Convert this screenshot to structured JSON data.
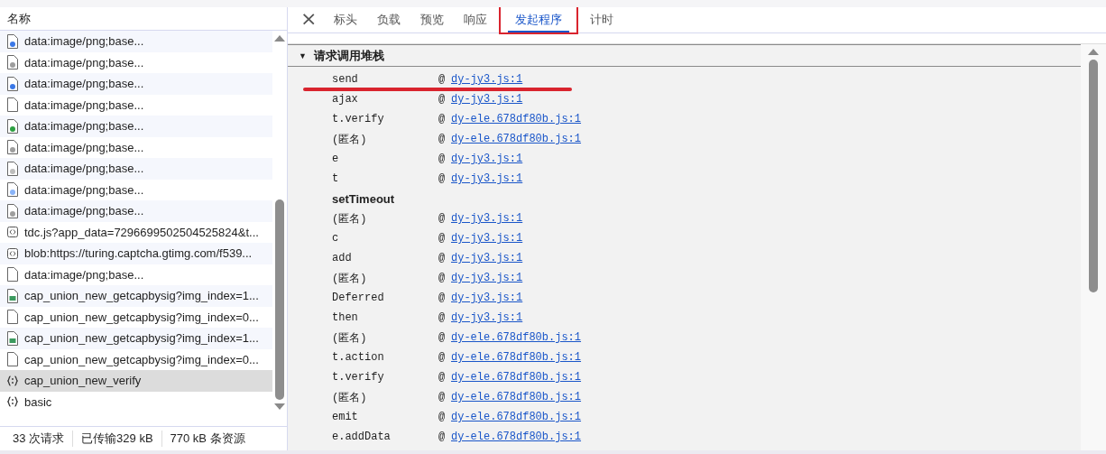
{
  "requests": {
    "column": "名称",
    "rows": [
      {
        "name": "data:image/png;base...",
        "kind": "file",
        "color": "#3b78e7",
        "selected": false
      },
      {
        "name": "data:image/png;base...",
        "kind": "file",
        "color": "#9e9e9e",
        "selected": false
      },
      {
        "name": "data:image/png;base...",
        "kind": "file",
        "color": "#3b78e7",
        "selected": false
      },
      {
        "name": "data:image/png;base...",
        "kind": "blank",
        "selected": false
      },
      {
        "name": "data:image/png;base...",
        "kind": "file",
        "color": "#2ea043",
        "selected": false
      },
      {
        "name": "data:image/png;base...",
        "kind": "file",
        "color": "#9e9e9e",
        "selected": false
      },
      {
        "name": "data:image/png;base...",
        "kind": "file",
        "color": "#bdbdbd",
        "selected": false
      },
      {
        "name": "data:image/png;base...",
        "kind": "file",
        "color": "#8ab4f8",
        "selected": false
      },
      {
        "name": "data:image/png;base...",
        "kind": "file",
        "color": "#9e9e9e",
        "selected": false
      },
      {
        "name": "tdc.js?app_data=7296699502504525824&t...",
        "kind": "script",
        "selected": false
      },
      {
        "name": "blob:https://turing.captcha.gtimg.com/f539...",
        "kind": "script",
        "selected": false
      },
      {
        "name": "data:image/png;base...",
        "kind": "blank",
        "selected": false
      },
      {
        "name": "cap_union_new_getcapbysig?img_index=1...",
        "kind": "image",
        "selected": false
      },
      {
        "name": "cap_union_new_getcapbysig?img_index=0...",
        "kind": "blank",
        "selected": false
      },
      {
        "name": "cap_union_new_getcapbysig?img_index=1...",
        "kind": "image",
        "selected": false
      },
      {
        "name": "cap_union_new_getcapbysig?img_index=0...",
        "kind": "blank",
        "selected": false
      },
      {
        "name": "cap_union_new_verify",
        "kind": "json",
        "selected": true
      },
      {
        "name": "basic",
        "kind": "json",
        "selected": false
      }
    ]
  },
  "summary": [
    "33 次请求",
    "已传输329 kB",
    "770 kB 条资源"
  ],
  "close": "×",
  "tabs": [
    {
      "label": "标头",
      "selected": false
    },
    {
      "label": "负载",
      "selected": false
    },
    {
      "label": "预览",
      "selected": false
    },
    {
      "label": "响应",
      "selected": false
    },
    {
      "label": "发起程序",
      "selected": true
    },
    {
      "label": "计时",
      "selected": false
    }
  ],
  "call_stack": {
    "title": "请求调用堆栈",
    "expanded": true,
    "toggle": "▼",
    "frames": [
      {
        "kind": "frame",
        "function": "send",
        "at": "@",
        "source": "dy-jy3.js:1"
      },
      {
        "kind": "frame",
        "function": "ajax",
        "at": "@",
        "source": "dy-jy3.js:1"
      },
      {
        "kind": "frame",
        "function": "t.verify",
        "at": "@",
        "source": "dy-ele.678df80b.js:1"
      },
      {
        "kind": "frame",
        "function": "(匿名)",
        "at": "@",
        "source": "dy-ele.678df80b.js:1"
      },
      {
        "kind": "frame",
        "function": "e",
        "at": "@",
        "source": "dy-jy3.js:1"
      },
      {
        "kind": "frame",
        "function": "t",
        "at": "@",
        "source": "dy-jy3.js:1"
      },
      {
        "kind": "async",
        "function": "setTimeout"
      },
      {
        "kind": "frame",
        "function": "(匿名)",
        "at": "@",
        "source": "dy-jy3.js:1"
      },
      {
        "kind": "frame",
        "function": "c",
        "at": "@",
        "source": "dy-jy3.js:1"
      },
      {
        "kind": "frame",
        "function": "add",
        "at": "@",
        "source": "dy-jy3.js:1"
      },
      {
        "kind": "frame",
        "function": "(匿名)",
        "at": "@",
        "source": "dy-jy3.js:1"
      },
      {
        "kind": "frame",
        "function": "Deferred",
        "at": "@",
        "source": "dy-jy3.js:1"
      },
      {
        "kind": "frame",
        "function": "then",
        "at": "@",
        "source": "dy-jy3.js:1"
      },
      {
        "kind": "frame",
        "function": "(匿名)",
        "at": "@",
        "source": "dy-ele.678df80b.js:1"
      },
      {
        "kind": "frame",
        "function": "t.action",
        "at": "@",
        "source": "dy-ele.678df80b.js:1"
      },
      {
        "kind": "frame",
        "function": "t.verify",
        "at": "@",
        "source": "dy-ele.678df80b.js:1"
      },
      {
        "kind": "frame",
        "function": "(匿名)",
        "at": "@",
        "source": "dy-ele.678df80b.js:1"
      },
      {
        "kind": "frame",
        "function": "emit",
        "at": "@",
        "source": "dy-ele.678df80b.js:1"
      },
      {
        "kind": "frame",
        "function": "e.addData",
        "at": "@",
        "source": "dy-ele.678df80b.js:1"
      }
    ]
  }
}
